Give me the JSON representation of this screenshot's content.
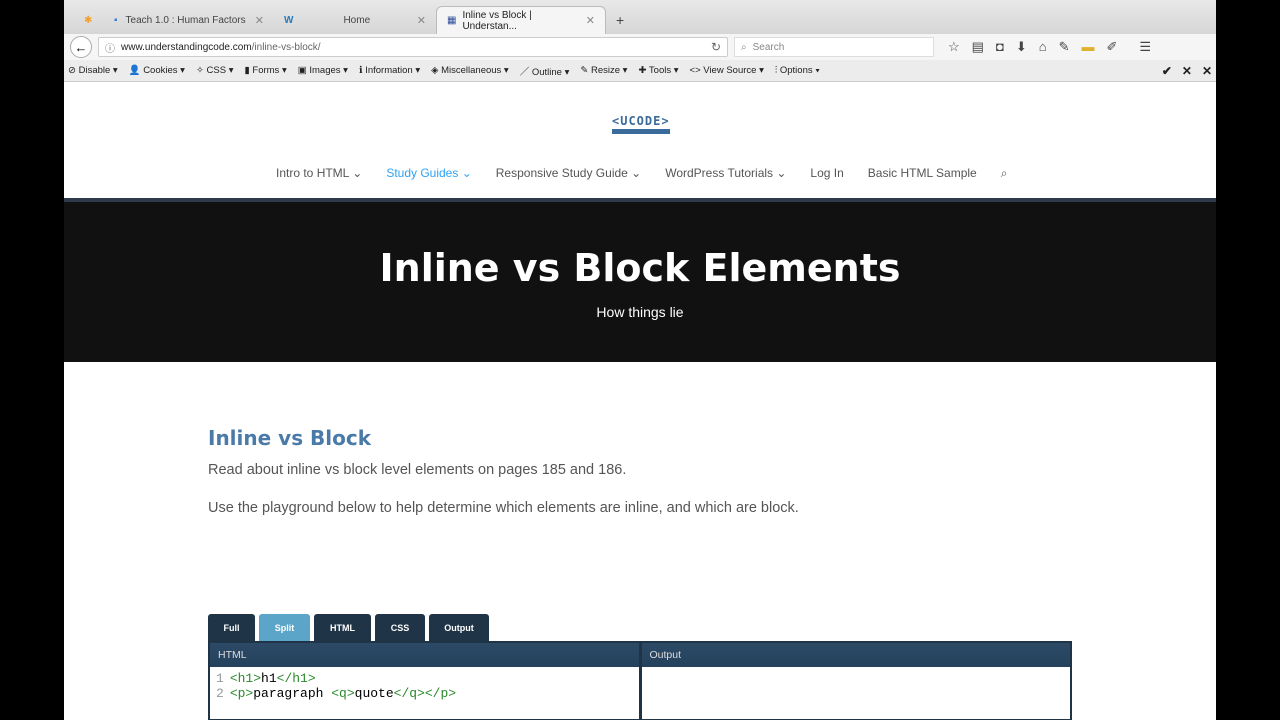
{
  "browser": {
    "tabs": [
      {
        "label": "Teach 1.0 : Human Factors"
      },
      {
        "label": "Home"
      },
      {
        "label": "Inline vs Block | Understan..."
      }
    ],
    "url_domain": "www.understandingcode.com",
    "url_path": "/inline-vs-block/",
    "search_placeholder": "Search"
  },
  "devbar": [
    "Disable",
    "Cookies",
    "CSS",
    "Forms",
    "Images",
    "Information",
    "Miscellaneous",
    "Outline",
    "Resize",
    "Tools",
    "View Source",
    "Options"
  ],
  "site": {
    "logo": "<UCODE>",
    "menu": [
      "Intro to HTML",
      "Study Guides",
      "Responsive Study Guide",
      "WordPress Tutorials",
      "Log In",
      "Basic HTML Sample"
    ]
  },
  "hero": {
    "title": "Inline vs Block Elements",
    "subtitle": "How things lie"
  },
  "content": {
    "heading": "Inline vs Block",
    "p1": "Read about inline vs block level elements on pages 185 and 186.",
    "p2": "Use the playground below to help determine which elements are inline, and which are block."
  },
  "playground": {
    "buttons": [
      "Full",
      "Split",
      "HTML",
      "CSS",
      "Output"
    ],
    "html_label": "HTML",
    "output_label": "Output",
    "code": [
      {
        "n": "1",
        "a": "<h1>",
        "b": "h1",
        "c": "</h1>"
      },
      {
        "n": "2",
        "a": "<p>",
        "b": "paragraph ",
        "c": "<q>",
        "d": "quote",
        "e": "</q></p>"
      }
    ]
  }
}
